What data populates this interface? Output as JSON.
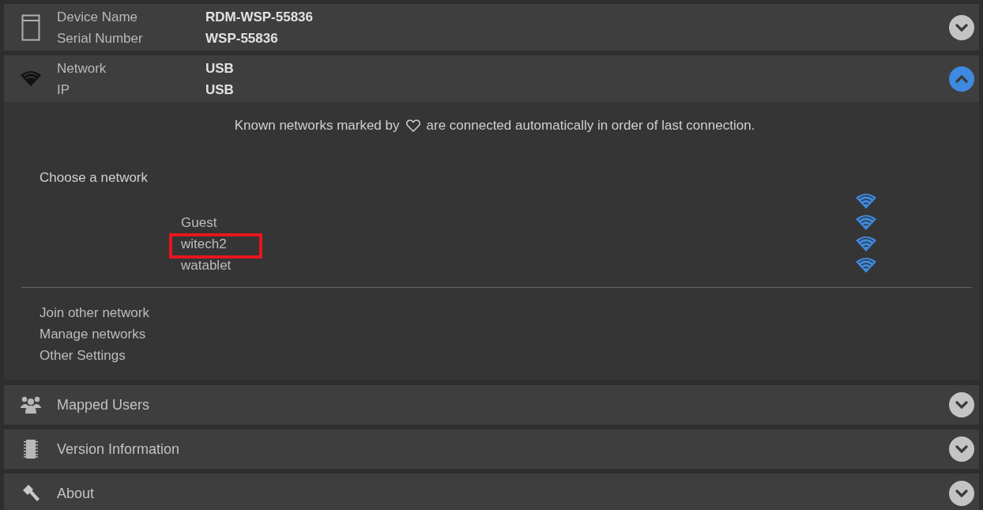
{
  "sections": [
    {
      "kind": "detail",
      "expanded": false,
      "rows": [
        {
          "label": "Device Name",
          "value": "RDM-WSP-55836"
        },
        {
          "label": "Serial Number",
          "value": "WSP-55836"
        }
      ]
    },
    {
      "kind": "detail",
      "expanded": true,
      "rows": [
        {
          "label": "Network",
          "value": "USB"
        },
        {
          "label": "IP",
          "value": "USB"
        }
      ],
      "body": {
        "info_before": "Known networks marked by",
        "info_after": "are connected automatically in order of last connection.",
        "choose_label": "Choose a network",
        "networks": [
          {
            "highlighted": false
          },
          {
            "name": "Guest",
            "highlighted": false
          },
          {
            "name": "witech2",
            "highlighted": true
          },
          {
            "name": "watablet",
            "highlighted": false
          }
        ],
        "links": [
          "Join other network",
          "Manage networks",
          "Other Settings"
        ]
      }
    },
    {
      "kind": "simple",
      "expanded": false,
      "title": "Mapped Users"
    },
    {
      "kind": "simple",
      "expanded": false,
      "title": "Version Information"
    },
    {
      "kind": "simple",
      "expanded": false,
      "title": "About"
    }
  ]
}
